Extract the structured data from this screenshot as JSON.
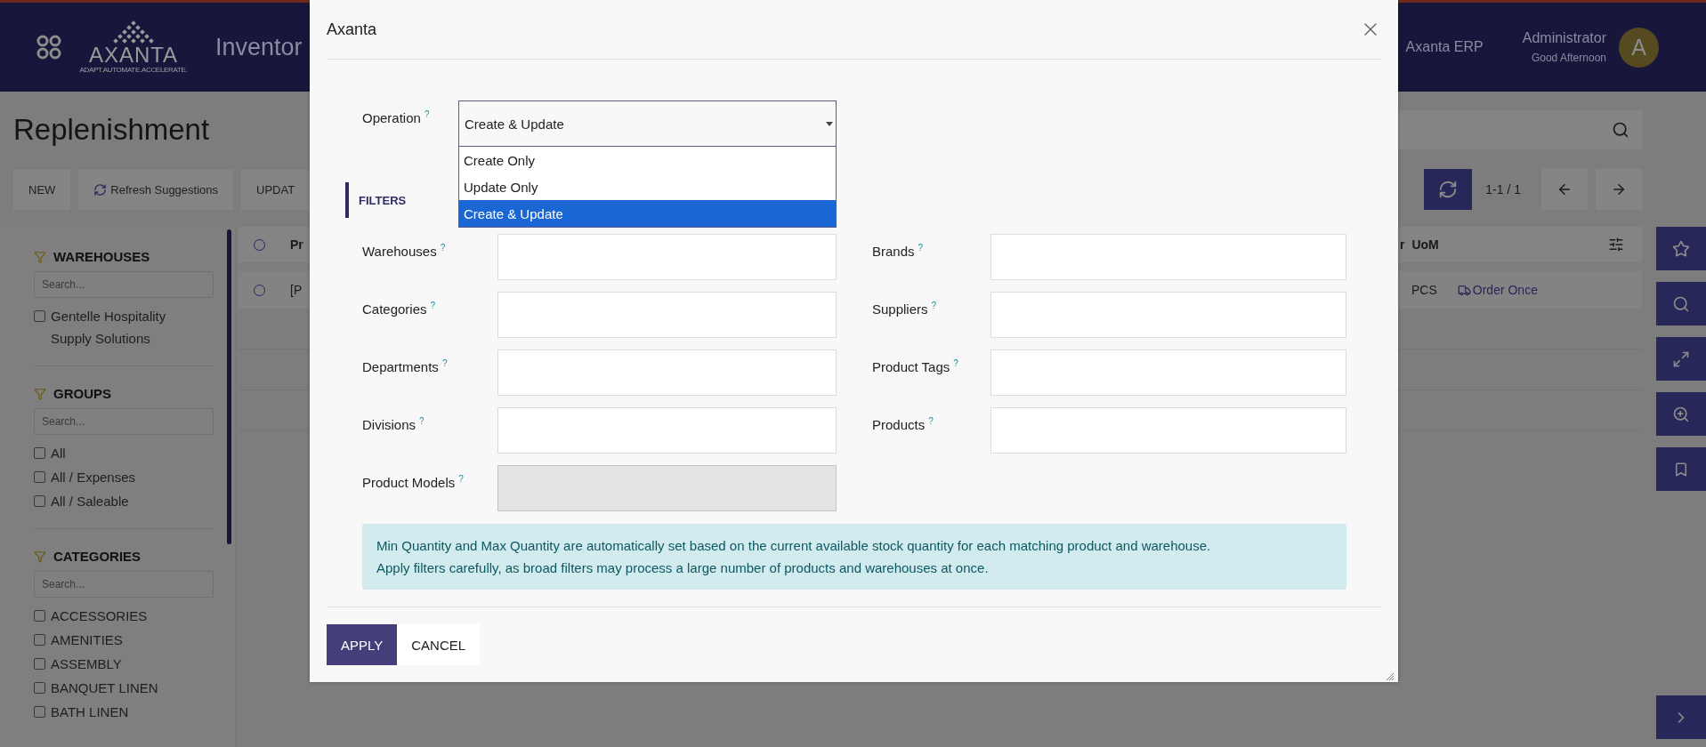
{
  "app_bar": {
    "logo_text": "AXANTA",
    "logo_tagline": "ADAPT.AUTOMATE.ACCELERATE.",
    "app_name": "Inventor",
    "company": "Axanta ERP",
    "user_name": "Administrator",
    "greeting": "Good Afternoon",
    "avatar_letter": "A"
  },
  "page": {
    "title": "Replenishment",
    "toolbar_buttons": [
      {
        "label": "NEW",
        "kind": "plain"
      },
      {
        "label": "Refresh Suggestions",
        "kind": "refresh"
      },
      {
        "label": "UPDAT",
        "kind": "plain"
      }
    ],
    "pager": "1-1 / 1"
  },
  "sidebar": {
    "sections": [
      {
        "title": "WAREHOUSES",
        "search_placeholder": "Search...",
        "items": [
          {
            "label": "Gentelle Hospitality Supply Solutions",
            "checked": false
          }
        ]
      },
      {
        "title": "GROUPS",
        "search_placeholder": "Search...",
        "items": [
          {
            "label": "All",
            "checked": false
          },
          {
            "label": "All / Expenses",
            "checked": false
          },
          {
            "label": "All / Saleable",
            "checked": false
          }
        ]
      },
      {
        "title": "CATEGORIES",
        "search_placeholder": "Search...",
        "items": [
          {
            "label": "ACCESSORIES",
            "checked": false
          },
          {
            "label": "AMENITIES",
            "checked": false
          },
          {
            "label": "ASSEMBLY",
            "checked": false
          },
          {
            "label": "BANQUET LINEN",
            "checked": false
          },
          {
            "label": "BATH LINEN",
            "checked": false
          }
        ]
      }
    ]
  },
  "table": {
    "header": {
      "selected": false,
      "column_1": "Pr",
      "column_2": "r",
      "column_3": "UoM"
    },
    "rows": [
      {
        "selected": false,
        "column_1": "[P",
        "uom": "PCS",
        "route": "Order Once"
      }
    ]
  },
  "dialog": {
    "title": "Axanta",
    "operation": {
      "label": "Operation",
      "help": "?",
      "value": "Create & Update",
      "options": [
        {
          "label": "Create Only",
          "selected": false
        },
        {
          "label": "Update Only",
          "selected": false
        },
        {
          "label": "Create & Update",
          "selected": true
        }
      ]
    },
    "section_title": "FILTERS",
    "fields": [
      {
        "label": "Warehouses",
        "help": "?",
        "disabled": false
      },
      {
        "label": "Brands",
        "help": "?",
        "disabled": false
      },
      {
        "label": "Categories",
        "help": "?",
        "disabled": false
      },
      {
        "label": "Suppliers",
        "help": "?",
        "disabled": false
      },
      {
        "label": "Departments",
        "help": "?",
        "disabled": false
      },
      {
        "label": "Product Tags",
        "help": "?",
        "disabled": false
      },
      {
        "label": "Divisions",
        "help": "?",
        "disabled": false
      },
      {
        "label": "Products",
        "help": "?",
        "disabled": false
      },
      {
        "label": "Product Models",
        "help": "?",
        "disabled": true
      }
    ],
    "info": [
      "Min Quantity and Max Quantity are automatically set based on the current available stock quantity for each matching product and warehouse.",
      "Apply filters carefully, as broad filters may process a large number of products and warehouses at once."
    ],
    "buttons": [
      {
        "label": "APPLY",
        "kind": "primary"
      },
      {
        "label": "CANCEL",
        "kind": "secondary"
      }
    ]
  }
}
